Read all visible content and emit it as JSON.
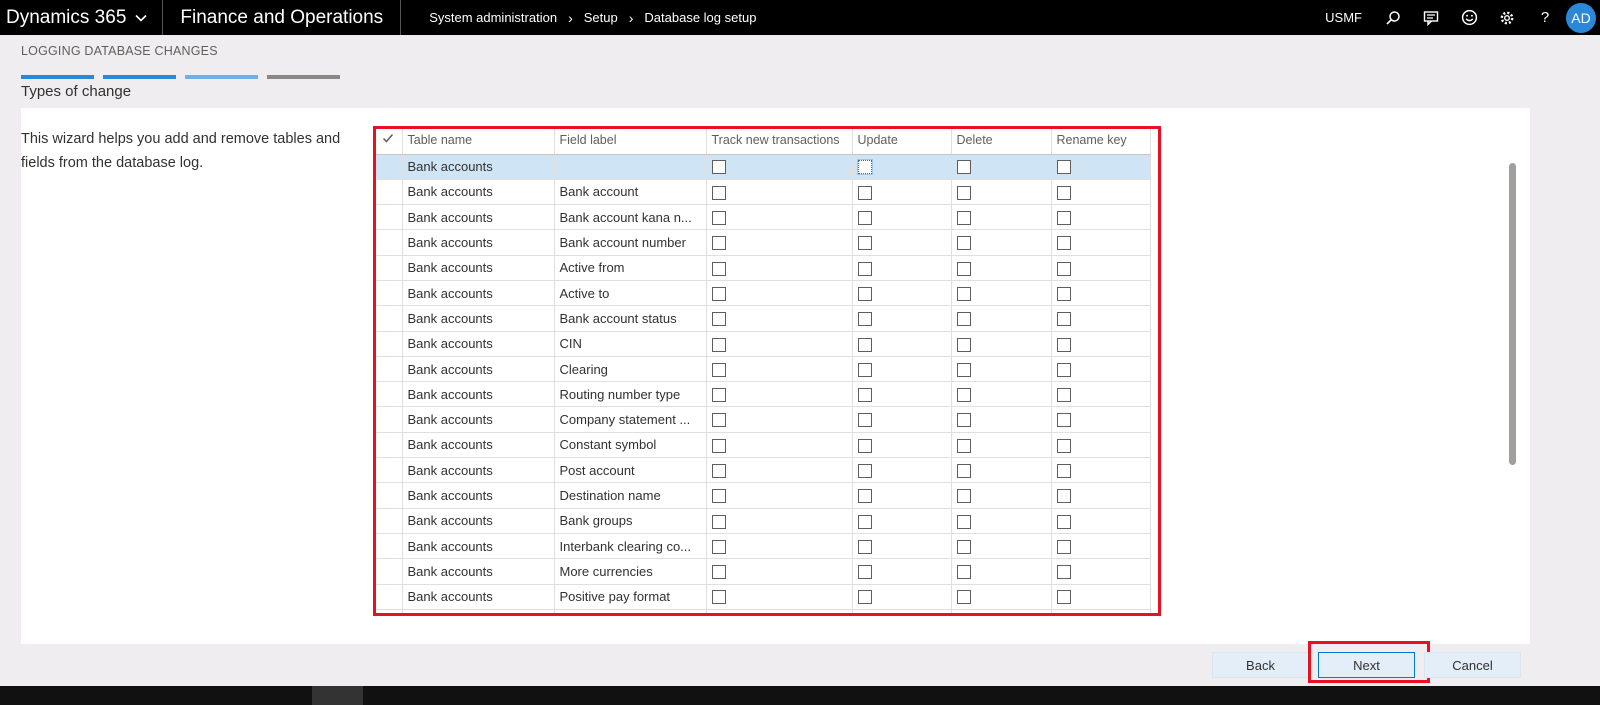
{
  "header": {
    "brand": "Dynamics 365",
    "app": "Finance and Operations",
    "breadcrumb": [
      "System administration",
      "Setup",
      "Database log setup"
    ],
    "company": "USMF",
    "avatar_initials": "AD",
    "icons": [
      "search-icon",
      "chat-icon",
      "smiley-icon",
      "gear-icon",
      "help-icon"
    ]
  },
  "wizard": {
    "title": "LOGGING DATABASE CHANGES",
    "step_colors": [
      "#2b88d8",
      "#2b88d8",
      "#71afe5",
      "#8a8886"
    ],
    "step_title": "Types of change",
    "description": "This wizard helps you add and remove tables and fields from the database log."
  },
  "grid": {
    "columns": [
      "Table name",
      "Field label",
      "Track new transactions",
      "Update",
      "Delete",
      "Rename key"
    ],
    "rows": [
      {
        "table": "Bank accounts",
        "field": ""
      },
      {
        "table": "Bank accounts",
        "field": "Bank account"
      },
      {
        "table": "Bank accounts",
        "field": "Bank account kana n..."
      },
      {
        "table": "Bank accounts",
        "field": "Bank account number"
      },
      {
        "table": "Bank accounts",
        "field": "Active from"
      },
      {
        "table": "Bank accounts",
        "field": "Active to"
      },
      {
        "table": "Bank accounts",
        "field": "Bank account status"
      },
      {
        "table": "Bank accounts",
        "field": "CIN"
      },
      {
        "table": "Bank accounts",
        "field": "Clearing"
      },
      {
        "table": "Bank accounts",
        "field": "Routing number type"
      },
      {
        "table": "Bank accounts",
        "field": "Company statement ..."
      },
      {
        "table": "Bank accounts",
        "field": "Constant symbol"
      },
      {
        "table": "Bank accounts",
        "field": "Post account"
      },
      {
        "table": "Bank accounts",
        "field": "Destination name"
      },
      {
        "table": "Bank accounts",
        "field": "Bank groups"
      },
      {
        "table": "Bank accounts",
        "field": "Interbank clearing co..."
      },
      {
        "table": "Bank accounts",
        "field": "More currencies"
      },
      {
        "table": "Bank accounts",
        "field": "Positive pay format"
      },
      {
        "table": "",
        "field": ""
      }
    ]
  },
  "footer": {
    "back": "Back",
    "next": "Next",
    "cancel": "Cancel"
  }
}
